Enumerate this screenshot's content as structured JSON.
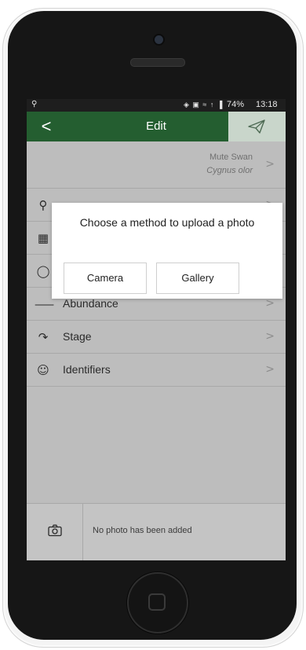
{
  "status_bar": {
    "left_icon": "location-pin-icon",
    "icons_text": "◈ ▣ ≈ ↑ ▐",
    "battery": "74%",
    "time": "13:18"
  },
  "header": {
    "back_glyph": "<",
    "title": "Edit",
    "send_icon": "paper-plane-icon"
  },
  "species": {
    "common_name": "Mute Swan",
    "latin_name": "Cygnus olor"
  },
  "rows": [
    {
      "label": "Abundance",
      "icon": "tally-marks-icon",
      "glyph": "⸺"
    },
    {
      "label": "Stage",
      "icon": "life-stage-icon",
      "glyph": "↷"
    },
    {
      "label": "Identifiers",
      "icon": "add-person-icon",
      "glyph": "☺"
    }
  ],
  "dialog": {
    "title": "Choose a method to upload a photo",
    "camera_label": "Camera",
    "gallery_label": "Gallery"
  },
  "photo_bar": {
    "empty_text": "No photo has been added"
  },
  "chevron": ">",
  "colors": {
    "header_green": "#245e30",
    "overlay_grey": "#bdbdbd",
    "send_area": "#c9d6cb"
  }
}
